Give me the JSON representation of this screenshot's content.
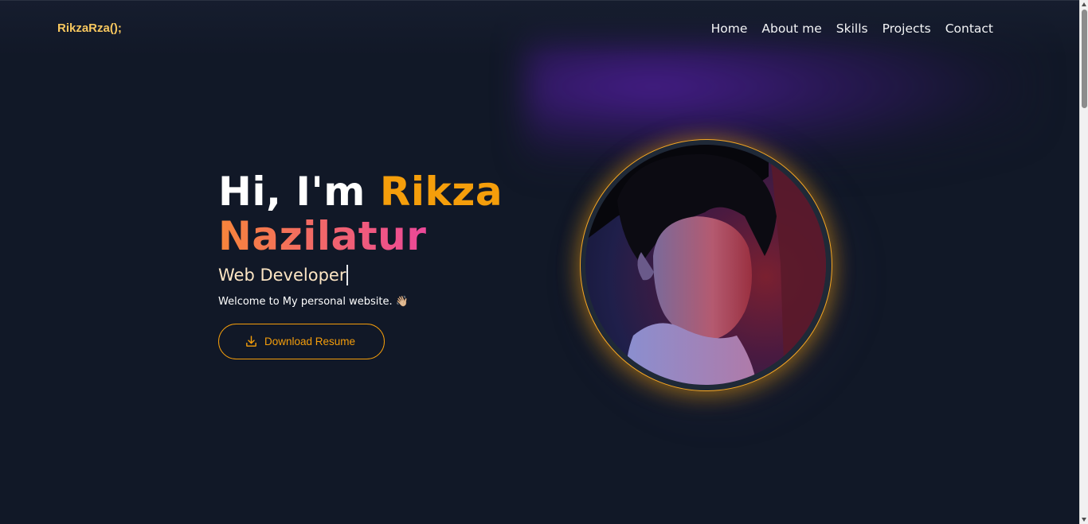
{
  "header": {
    "logo": "RikzaRza();",
    "nav": [
      "Home",
      "About me",
      "Skills",
      "Projects",
      "Contact"
    ]
  },
  "hero": {
    "greeting": "Hi, I'm",
    "first_name": "Rikza",
    "last_name": "Nazilatur",
    "role": "Web Developer",
    "welcome": "Welcome to My personal website. 👋🏼",
    "button_label": "Download Resume",
    "button_icon": "download-icon"
  },
  "colors": {
    "background": "#111827",
    "logo": "#f7c75e",
    "accent": "#f59e0b",
    "gradient_start": "#f7853a",
    "gradient_end": "#ec4899"
  }
}
